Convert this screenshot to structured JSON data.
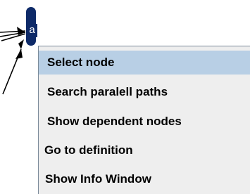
{
  "graph": {
    "node": {
      "label": "a",
      "color": "#0e2a68"
    }
  },
  "context_menu": {
    "items": [
      {
        "label": "Select node",
        "selected": true
      },
      {
        "label": "Search paralell paths",
        "selected": false
      },
      {
        "label": "Show dependent nodes",
        "selected": false
      },
      {
        "label": "Go to definition",
        "selected": false
      },
      {
        "label": "Show Info Window",
        "selected": false
      }
    ],
    "background_color": "#eeeeee",
    "highlight_color": "#b8cfe5"
  }
}
